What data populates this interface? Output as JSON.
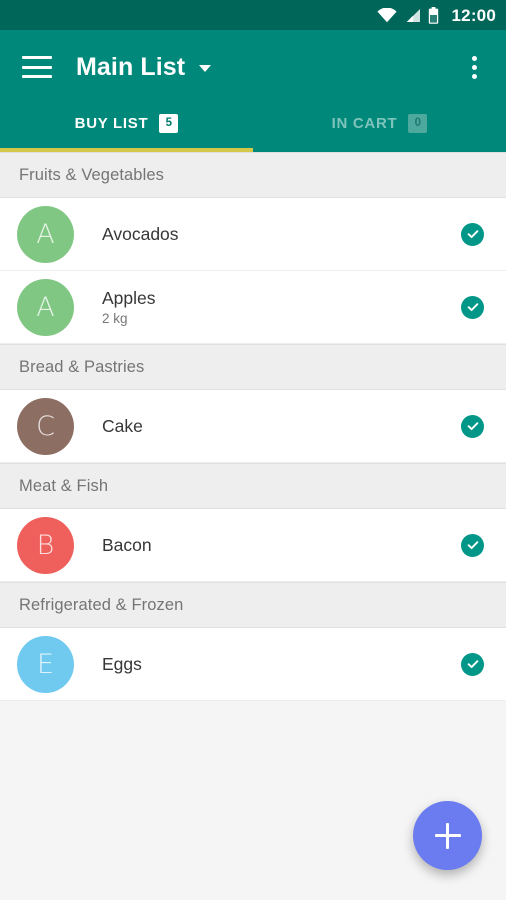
{
  "status_bar": {
    "time": "12:00",
    "icons": [
      "wifi-icon",
      "cell-signal-icon",
      "battery-icon"
    ],
    "background": "#00665a"
  },
  "app_bar": {
    "menu_icon": "hamburger-menu-icon",
    "title": "Main List",
    "dropdown_icon": "chevron-down-icon",
    "overflow_icon": "more-vertical-icon",
    "background": "#00897b"
  },
  "tabs": {
    "indicator_color": "#d4c84a",
    "items": [
      {
        "label": "BUY LIST",
        "badge": "5",
        "active": true
      },
      {
        "label": "IN CART",
        "badge": "0",
        "active": false
      }
    ]
  },
  "list": {
    "sections": [
      {
        "header": "Fruits & Vegetables",
        "items": [
          {
            "title": "Avocados",
            "subtitle": "",
            "avatar_letter": "A",
            "avatar_color": "#81c784",
            "checked": true,
            "check_color": "#009688"
          },
          {
            "title": "Apples",
            "subtitle": "2 kg",
            "avatar_letter": "A",
            "avatar_color": "#81c784",
            "checked": true,
            "check_color": "#009688"
          }
        ]
      },
      {
        "header": "Bread & Pastries",
        "items": [
          {
            "title": "Cake",
            "subtitle": "",
            "avatar_letter": "C",
            "avatar_color": "#8d6e63",
            "checked": true,
            "check_color": "#009688"
          }
        ]
      },
      {
        "header": "Meat & Fish",
        "items": [
          {
            "title": "Bacon",
            "subtitle": "",
            "avatar_letter": "B",
            "avatar_color": "#ef5f5c",
            "checked": true,
            "check_color": "#009688"
          }
        ]
      },
      {
        "header": "Refrigerated & Frozen",
        "items": [
          {
            "title": "Eggs",
            "subtitle": "",
            "avatar_letter": "E",
            "avatar_color": "#70c9ef",
            "checked": true,
            "check_color": "#009688"
          }
        ]
      }
    ]
  },
  "fab": {
    "icon": "plus-icon",
    "color": "#6b7bf0"
  }
}
